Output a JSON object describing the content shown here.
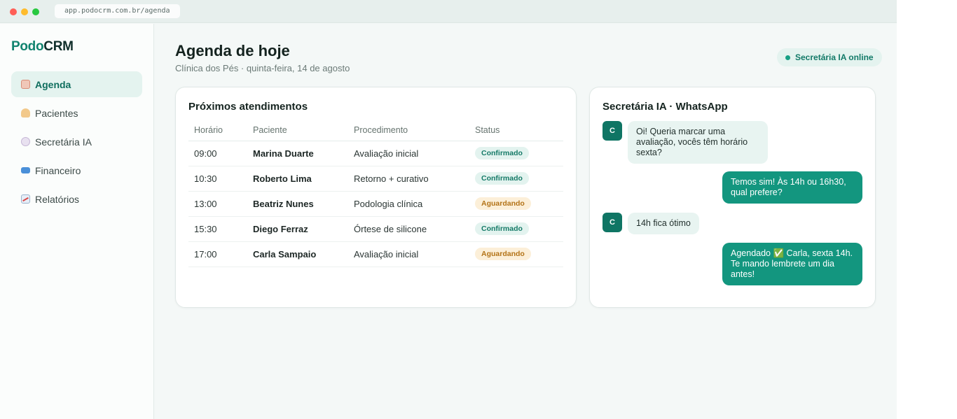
{
  "browser": {
    "url": "app.podocrm.com.br/agenda"
  },
  "brand": {
    "part1": "Podo",
    "part2": "CRM",
    "accent": "#11836f"
  },
  "sidebar": {
    "items": [
      {
        "label": "Agenda",
        "icon": "clipboard-icon",
        "active": true
      },
      {
        "label": "Pacientes",
        "icon": "person-icon",
        "active": false
      },
      {
        "label": "Secretária IA",
        "icon": "speech-bubble-icon",
        "active": false
      },
      {
        "label": "Financeiro",
        "icon": "credit-card-icon",
        "active": false
      },
      {
        "label": "Relatórios",
        "icon": "chart-icon",
        "active": false
      }
    ]
  },
  "header": {
    "title": "Agenda de hoje",
    "subtitle": "Clínica dos Pés · quinta-feira, 14 de agosto",
    "status": "Secretária IA online"
  },
  "appointments": {
    "title": "Próximos atendimentos",
    "columns": [
      "Horário",
      "Paciente",
      "Procedimento",
      "Status"
    ],
    "rows": [
      {
        "time": "09:00",
        "patient": "Marina Duarte",
        "procedure": "Avaliação inicial",
        "status": "Confirmado",
        "status_type": "ok"
      },
      {
        "time": "10:30",
        "patient": "Roberto Lima",
        "procedure": "Retorno + curativo",
        "status": "Confirmado",
        "status_type": "ok"
      },
      {
        "time": "13:00",
        "patient": "Beatriz Nunes",
        "procedure": "Podologia clínica",
        "status": "Aguardando",
        "status_type": "wait"
      },
      {
        "time": "15:30",
        "patient": "Diego Ferraz",
        "procedure": "Órtese de silicone",
        "status": "Confirmado",
        "status_type": "ok"
      },
      {
        "time": "17:00",
        "patient": "Carla Sampaio",
        "procedure": "Avaliação inicial",
        "status": "Aguardando",
        "status_type": "wait"
      }
    ]
  },
  "chat": {
    "title": "Secretária IA · WhatsApp",
    "avatar": "C",
    "messages": [
      {
        "from": "in",
        "text": "Oi! Queria marcar uma avaliação, vocês têm horário sexta?"
      },
      {
        "from": "out",
        "text": "Temos sim! Às 14h ou 16h30, qual prefere?"
      },
      {
        "from": "in",
        "text": "14h fica ótimo"
      },
      {
        "from": "out",
        "text": "Agendado ✅ Carla, sexta 14h. Te mando lembrete um dia antes!"
      }
    ]
  }
}
